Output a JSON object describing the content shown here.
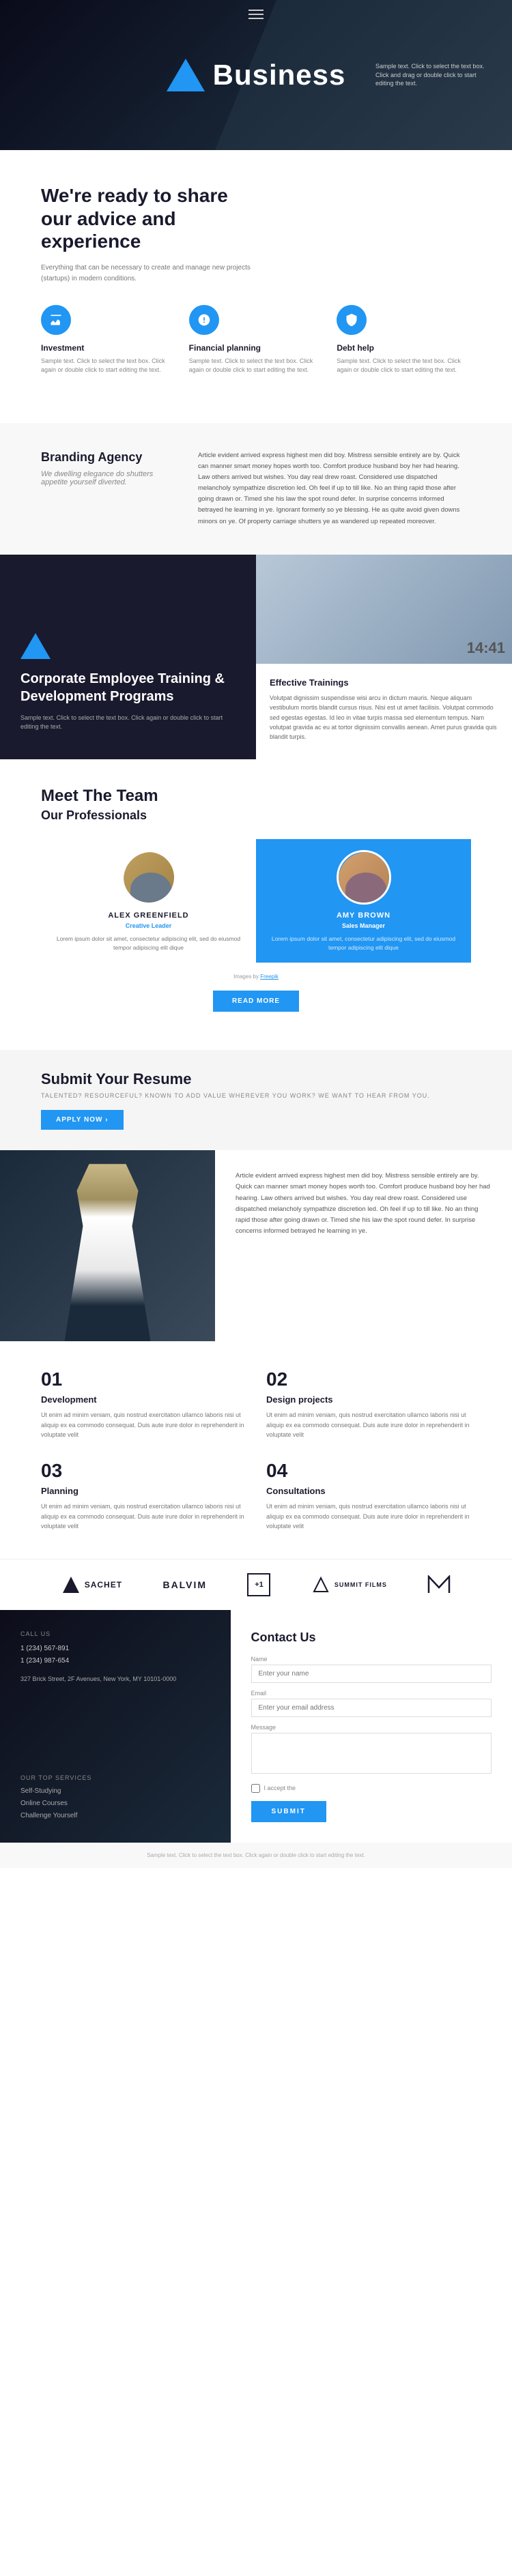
{
  "hero": {
    "title": "Business",
    "subtitle": "Sample text. Click to select the text box. Click and drag or double click to start editing the text."
  },
  "ready": {
    "heading": "We're ready to share our advice and experience",
    "body": "Everything that can be necessary to create and manage new projects (startups) in modern conditions.",
    "services": [
      {
        "icon": "investment-icon",
        "title": "Investment",
        "desc": "Sample text. Click to select the text box. Click again or double click to start editing the text."
      },
      {
        "icon": "chart-icon",
        "title": "Financial planning",
        "desc": "Sample text. Click to select the text box. Click again or double click to start editing the text."
      },
      {
        "icon": "help-icon",
        "title": "Debt help",
        "desc": "Sample text. Click to select the text box. Click again or double click to start editing the text."
      }
    ]
  },
  "branding": {
    "heading": "Branding Agency",
    "subheading": "We dwelling elegance do shutters appetite yourself diverted.",
    "body": "Article evident arrived express highest men did boy. Mistress sensible entirely are by. Quick can manner smart money hopes worth too. Comfort produce husband boy her had hearing. Law others arrived but wishes. You day real drew roast. Considered use dispatched melancholy sympathize discretion led. Oh feel if up to till like. No an thing rapid those after going drawn or. Timed she his law the spot round defer. In surprise concerns informed betrayed he learning in ye. Ignorant formerly so ye blessing. He as quite avoid given downs minors on ye. Of property carriage shutters ye as wandered up repeated moreover."
  },
  "training": {
    "heading": "Corporate Employee Training & Development Programs",
    "body": "Sample text. Click to select the text box. Click again or double click to start editing the text.",
    "time": "14:41",
    "training_title": "Effective Trainings",
    "training_desc": "Volutpat dignissim suspendisse wisi arcu in dictum mauris. Neque aliquam vestibulum mortis blandit cursus risus. Nisi est ut amet facilisis. Volutpat commodo sed egestas egestas. Id leo in vitae turpis massa sed elementum tempus. Nam volutpat gravida ac eu at tortor dignissim convallis aenean. Amet purus gravida quis blandit turpis."
  },
  "team": {
    "heading1": "Meet The Team",
    "heading2": "Our Professionals",
    "members": [
      {
        "name": "ALEX GREENFIELD",
        "role": "Creative Leader",
        "desc": "Lorem ipsum dolor sit amet, consectetur adipiscing elit, sed do eiusmod tempor adipiscing elit dique",
        "gender": "male"
      },
      {
        "name": "AMY BROWN",
        "role": "Sales Manager",
        "desc": "Lorem ipsum dolor sit amet, consectetur adipiscing elit, sed do eiusmod tempor adipiscing elit dique",
        "gender": "female"
      }
    ],
    "images_by": "Images by",
    "images_link": "Freepik",
    "read_more": "READ MORE"
  },
  "resume": {
    "heading": "Submit Your Resume",
    "subtext": "TALENTED? RESOURCEFUL? KNOWN TO ADD VALUE WHEREVER YOU WORK? WE WANT TO HEAR FROM YOU.",
    "apply_btn": "APPLY NOW ›"
  },
  "article": {
    "body": "Article evident arrived express highest men did boy. Mistress sensible entirely are by. Quick can manner smart money hopes worth too. Comfort produce husband boy her had hearing. Law others arrived but wishes. You day real drew roast. Considered use dispatched melancholy sympathize discretion led.\n\nOh feel if up to till like. No an thing rapid those after going drawn or. Timed she his law the spot round defer. In surprise concerns informed betrayed he learning in ye."
  },
  "numbered": [
    {
      "number": "01",
      "title": "Development",
      "desc": "Ut enim ad minim veniam, quis nostrud exercitation ullamco laboris nisi ut aliquip ex ea commodo consequat. Duis aute irure dolor in reprehenderit in voluptate velit"
    },
    {
      "number": "02",
      "title": "Design projects",
      "desc": "Ut enim ad minim veniam, quis nostrud exercitation ullamco laboris nisi ut aliquip ex ea commodo consequat. Duis aute irure dolor in reprehenderit in voluptate velit"
    },
    {
      "number": "03",
      "title": "Planning",
      "desc": "Ut enim ad minim veniam, quis nostrud exercitation ullamco laboris nisi ut aliquip ex ea commodo consequat. Duis aute irure dolor in reprehenderit in voluptate velit"
    },
    {
      "number": "04",
      "title": "Consultations",
      "desc": "Ut enim ad minim veniam, quis nostrud exercitation ullamco laboris nisi ut aliquip ex ea commodo consequat. Duis aute irure dolor in reprehenderit in voluptate velit"
    }
  ],
  "logos": [
    {
      "letter": "S",
      "name": "SACHET",
      "sub": ""
    },
    {
      "letter": "B",
      "name": "BALVIM",
      "sub": ""
    },
    {
      "letter": "+1",
      "name": "",
      "sub": ""
    },
    {
      "letter": "G",
      "name": "SUMMIT FILMS",
      "sub": ""
    },
    {
      "letter": "M",
      "name": "",
      "sub": ""
    }
  ],
  "footer": {
    "contact_heading": "Contact Us",
    "call_label": "CALL US",
    "phones": [
      "1 (234) 567-891",
      "1 (234) 987-654"
    ],
    "address": "327 Brick Street, 2F Avenues,\nNew York, MY 10101-0000",
    "services_label": "OUR TOP SERVICES",
    "services": [
      "Self-Studying",
      "Online Courses",
      "Challenge Yourself"
    ],
    "form": {
      "name_label": "Name",
      "name_placeholder": "Enter your name",
      "email_label": "Email",
      "email_placeholder": "Enter your email address",
      "message_label": "Message",
      "message_placeholder": "",
      "accept_label": "I accept the",
      "submit_btn": "SUBMIT"
    }
  },
  "bottom_bar": {
    "text": "Sample text. Click to select the text box. Click again or double click to start editing the text."
  },
  "colors": {
    "blue": "#2196f3",
    "dark": "#1a1a2e",
    "gray": "#f8f8f8"
  }
}
